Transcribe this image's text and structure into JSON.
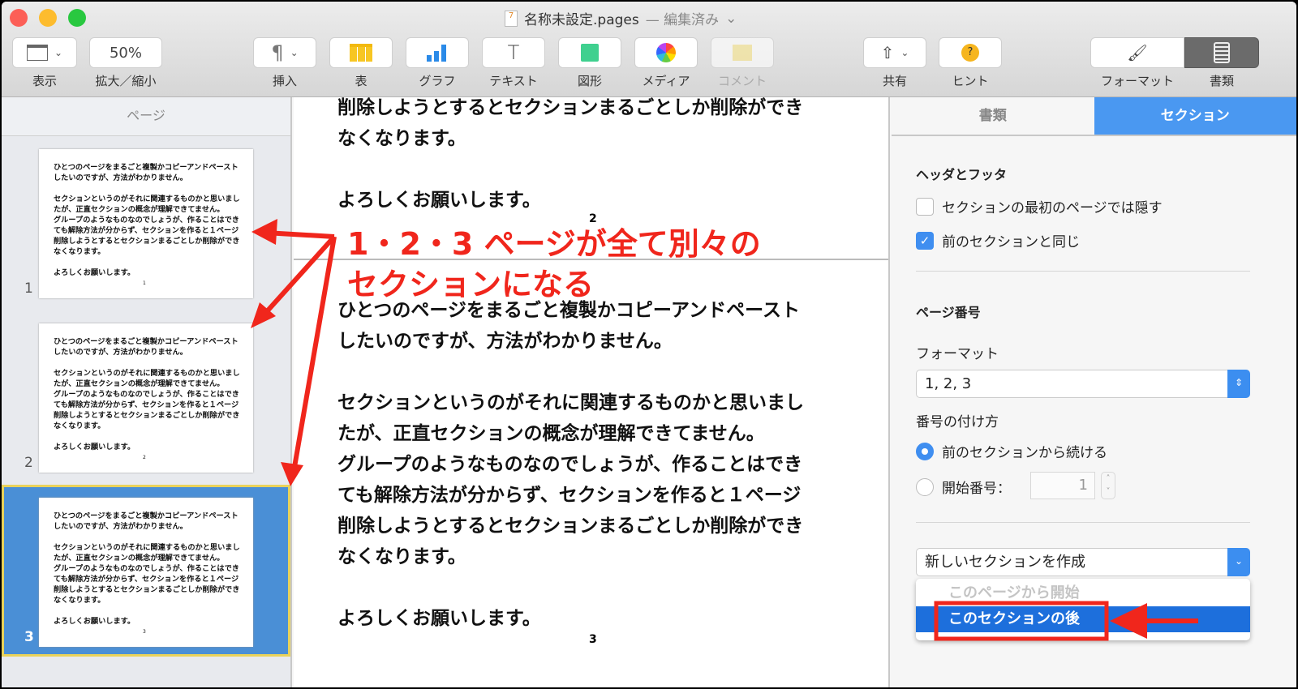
{
  "window": {
    "title": "名称未設定.pages",
    "status": "— 編集済み",
    "title_chevron": "⌄"
  },
  "toolbar": {
    "view": {
      "label": "表示"
    },
    "zoom": {
      "value": "50%",
      "label": "拡大／縮小"
    },
    "insert": {
      "icon": "¶",
      "label": "挿入"
    },
    "table": {
      "label": "表"
    },
    "chart": {
      "label": "グラフ"
    },
    "text": {
      "icon": "T",
      "label": "テキスト"
    },
    "shape": {
      "label": "図形"
    },
    "media": {
      "label": "メディア"
    },
    "comment": {
      "label": "コメント"
    },
    "share": {
      "label": "共有"
    },
    "tips": {
      "icon": "?",
      "label": "ヒント"
    },
    "format": {
      "label": "フォーマット"
    },
    "document": {
      "label": "書類"
    }
  },
  "sidebar": {
    "header": "ページ",
    "thumbnails": [
      {
        "number": "1",
        "page_num": "1"
      },
      {
        "number": "2",
        "page_num": "2"
      },
      {
        "number": "3",
        "page_num": "3"
      }
    ]
  },
  "document": {
    "paragraphs": [
      "ひとつのページをまるごと複製かコピーアンドペースト",
      "したいのですが、方法がわかりません。",
      "",
      "セクションというのがそれに関連するものかと思いまし",
      "たが、正直セクションの概念が理解できてません。",
      "グループのようなものなのでしょうが、作ることはでき",
      "ても解除方法が分からず、セクションを作ると１ページ",
      "削除しようとするとセクションまるごとしか削除ができ",
      "なくなります。",
      "",
      "よろしくお願いします。"
    ],
    "page2_tail": [
      "削除しようとするとセクションまるごとしか削除ができ",
      "なくなります。",
      "",
      "よろしくお願いします。"
    ],
    "page2_number": "2",
    "page3_number": "3"
  },
  "annotation": {
    "line1": "1・2・3 ページが全て別々の",
    "line2": "セクションになる",
    "color": "#f0261c"
  },
  "inspector": {
    "tabs": [
      {
        "label": "書類",
        "active": false
      },
      {
        "label": "セクション",
        "active": true
      }
    ],
    "header_footer": {
      "title": "ヘッダとフッタ",
      "hide_first": {
        "label": "セクションの最初のページでは隠す",
        "checked": false
      },
      "same_as_prev": {
        "label": "前のセクションと同じ",
        "checked": true
      }
    },
    "page_numbers": {
      "title": "ページ番号",
      "format_label": "フォーマット",
      "format_value": "1, 2, 3",
      "numbering_label": "番号の付け方",
      "continue": {
        "label": "前のセクションから続ける",
        "selected": true
      },
      "start_at": {
        "label": "開始番号：",
        "selected": false,
        "value": "1"
      }
    },
    "new_section": {
      "label": "新しいセクションを作成",
      "options": [
        {
          "label": "このページから開始",
          "enabled": false
        },
        {
          "label": "このセクションの後",
          "highlighted": true
        }
      ]
    }
  }
}
